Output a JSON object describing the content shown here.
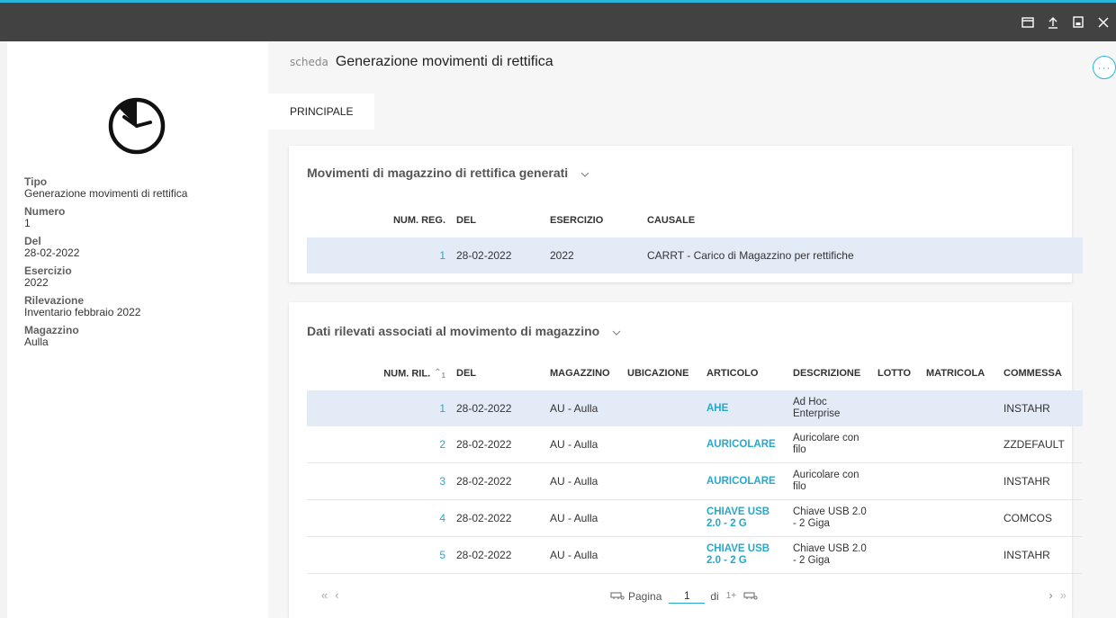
{
  "window": {
    "accent_color": "#29b6d9",
    "icons": [
      "window-icon",
      "upload-icon",
      "save-icon",
      "close-icon"
    ]
  },
  "record": {
    "icon": "clock-icon",
    "props": [
      {
        "label": "Tipo",
        "value": "Generazione movimenti di rettifica"
      },
      {
        "label": "Numero",
        "value": "1"
      },
      {
        "label": "Del",
        "value": "28-02-2022"
      },
      {
        "label": "Esercizio",
        "value": "2022"
      },
      {
        "label": "Rilevazione",
        "value": "Inventario febbraio 2022"
      },
      {
        "label": "Magazzino",
        "value": "Aulla"
      }
    ]
  },
  "header": {
    "prefix": "scheda",
    "title": "Generazione movimenti di rettifica",
    "more_label": "···"
  },
  "tabs": [
    {
      "label": "PRINCIPALE"
    }
  ],
  "section1": {
    "title": "Movimenti di magazzino di rettifica generati",
    "columns": [
      "NUM. REG.",
      "DEL",
      "ESERCIZIO",
      "CAUSALE"
    ],
    "rows": [
      {
        "num": "1",
        "del": "28-02-2022",
        "esercizio": "2022",
        "causale": "CARRT - Carico di Magazzino per rettifiche"
      }
    ]
  },
  "section2": {
    "title": "Dati rilevati associati al movimento di magazzino",
    "columns": [
      "NUM. RIL.",
      "DEL",
      "MAGAZZINO",
      "UBICAZIONE",
      "ARTICOLO",
      "DESCRIZIONE",
      "LOTTO",
      "MATRICOLA",
      "COMMESSA"
    ],
    "sort_indicator": "1",
    "rows": [
      {
        "num": "1",
        "del": "28-02-2022",
        "magazzino": "AU - Aulla",
        "ubicazione": "",
        "articolo": "AHE",
        "descrizione": "Ad Hoc Enterprise",
        "lotto": "",
        "matricola": "",
        "commessa": "INSTAHR"
      },
      {
        "num": "2",
        "del": "28-02-2022",
        "magazzino": "AU - Aulla",
        "ubicazione": "",
        "articolo": "AURICOLARE",
        "descrizione": "Auricolare con filo",
        "lotto": "",
        "matricola": "",
        "commessa": "ZZDEFAULT"
      },
      {
        "num": "3",
        "del": "28-02-2022",
        "magazzino": "AU - Aulla",
        "ubicazione": "",
        "articolo": "AURICOLARE",
        "descrizione": "Auricolare con filo",
        "lotto": "",
        "matricola": "",
        "commessa": "INSTAHR"
      },
      {
        "num": "4",
        "del": "28-02-2022",
        "magazzino": "AU - Aulla",
        "ubicazione": "",
        "articolo": "CHIAVE USB 2.0 - 2 G",
        "descrizione": "Chiave USB 2.0 - 2 Giga",
        "lotto": "",
        "matricola": "",
        "commessa": "COMCOS"
      },
      {
        "num": "5",
        "del": "28-02-2022",
        "magazzino": "AU - Aulla",
        "ubicazione": "",
        "articolo": "CHIAVE USB 2.0 - 2 G",
        "descrizione": "Chiave USB 2.0 - 2 Giga",
        "lotto": "",
        "matricola": "",
        "commessa": "INSTAHR"
      }
    ],
    "pager": {
      "first": "«",
      "prev": "‹",
      "next": "›",
      "last": "»",
      "page_label": "Pagina",
      "page_value": "1",
      "of_label": "di",
      "total": "1+"
    }
  }
}
